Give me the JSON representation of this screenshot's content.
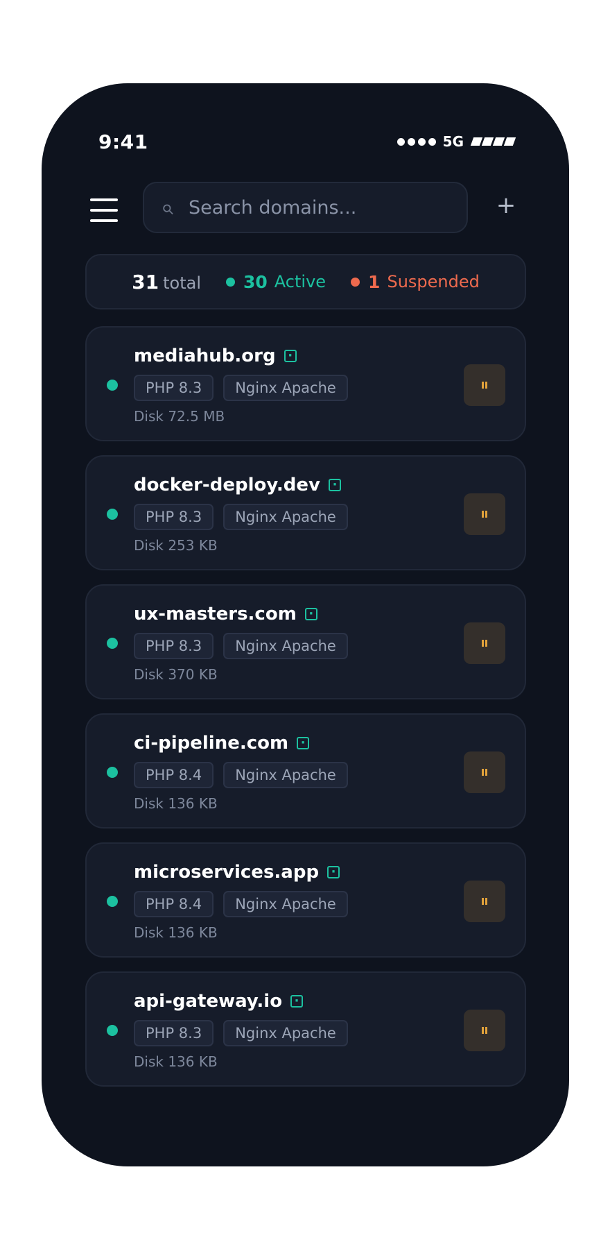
{
  "status_bar": {
    "time": "9:41",
    "network": "5G"
  },
  "search": {
    "placeholder": "Search domains..."
  },
  "summary": {
    "total_count": "31",
    "total_label": "total",
    "active_count": "30",
    "active_label": "Active",
    "suspended_count": "1",
    "suspended_label": "Suspended"
  },
  "colors": {
    "background": "#0e131e",
    "card": "#161c2a",
    "active": "#1cc1a0",
    "suspended": "#ee6a4e",
    "pause": "#e3a33b"
  },
  "domains": [
    {
      "name": "mediahub.org",
      "php": "PHP 8.3",
      "server": "Nginx Apache",
      "disk": "Disk 72.5 MB",
      "status": "active"
    },
    {
      "name": "docker-deploy.dev",
      "php": "PHP 8.3",
      "server": "Nginx Apache",
      "disk": "Disk 253 KB",
      "status": "active"
    },
    {
      "name": "ux-masters.com",
      "php": "PHP 8.3",
      "server": "Nginx Apache",
      "disk": "Disk 370 KB",
      "status": "active"
    },
    {
      "name": "ci-pipeline.com",
      "php": "PHP 8.4",
      "server": "Nginx Apache",
      "disk": "Disk 136 KB",
      "status": "active"
    },
    {
      "name": "microservices.app",
      "php": "PHP 8.4",
      "server": "Nginx Apache",
      "disk": "Disk 136 KB",
      "status": "active"
    },
    {
      "name": "api-gateway.io",
      "php": "PHP 8.3",
      "server": "Nginx Apache",
      "disk": "Disk 136 KB",
      "status": "active"
    }
  ]
}
